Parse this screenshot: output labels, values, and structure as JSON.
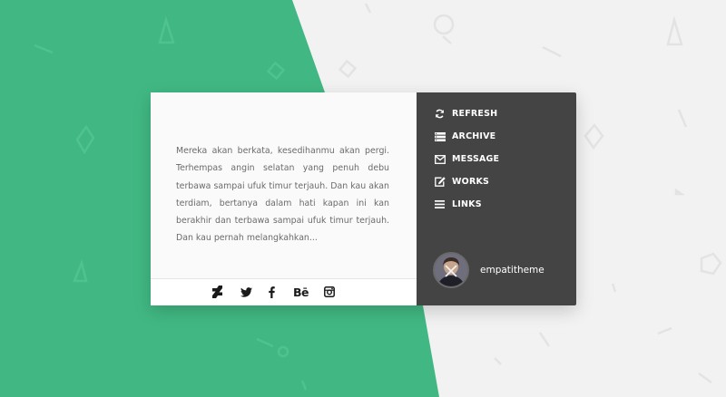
{
  "theme": {
    "accent": "#41b883",
    "background": "#f2f2f2",
    "panel_dark": "#444444",
    "card_light": "#fafafa"
  },
  "profile": {
    "description": "Mereka akan berkata, kesedihanmu akan pergi. Terhempas angin selatan yang penuh debu terbawa sampai ufuk timur terjauh. Dan kau akan terdiam, bertanya dalam hati kapan ini kan berakhir dan terbawa sampai ufuk timur terjauh. Dan kau pernah melangkahkan...",
    "username": "empatitheme",
    "avatar_icon": "avatar-photo"
  },
  "social": [
    {
      "name": "deviantart",
      "icon": "deviantart-icon"
    },
    {
      "name": "twitter",
      "icon": "twitter-icon"
    },
    {
      "name": "facebook",
      "icon": "facebook-icon"
    },
    {
      "name": "behance",
      "icon": "behance-icon"
    },
    {
      "name": "instagram",
      "icon": "instagram-icon"
    }
  ],
  "menu": [
    {
      "label": "REFRESH",
      "icon": "refresh-icon"
    },
    {
      "label": "ARCHIVE",
      "icon": "archive-icon"
    },
    {
      "label": "MESSAGE",
      "icon": "envelope-icon"
    },
    {
      "label": "WORKS",
      "icon": "edit-icon"
    },
    {
      "label": "LINKS",
      "icon": "list-icon"
    }
  ]
}
